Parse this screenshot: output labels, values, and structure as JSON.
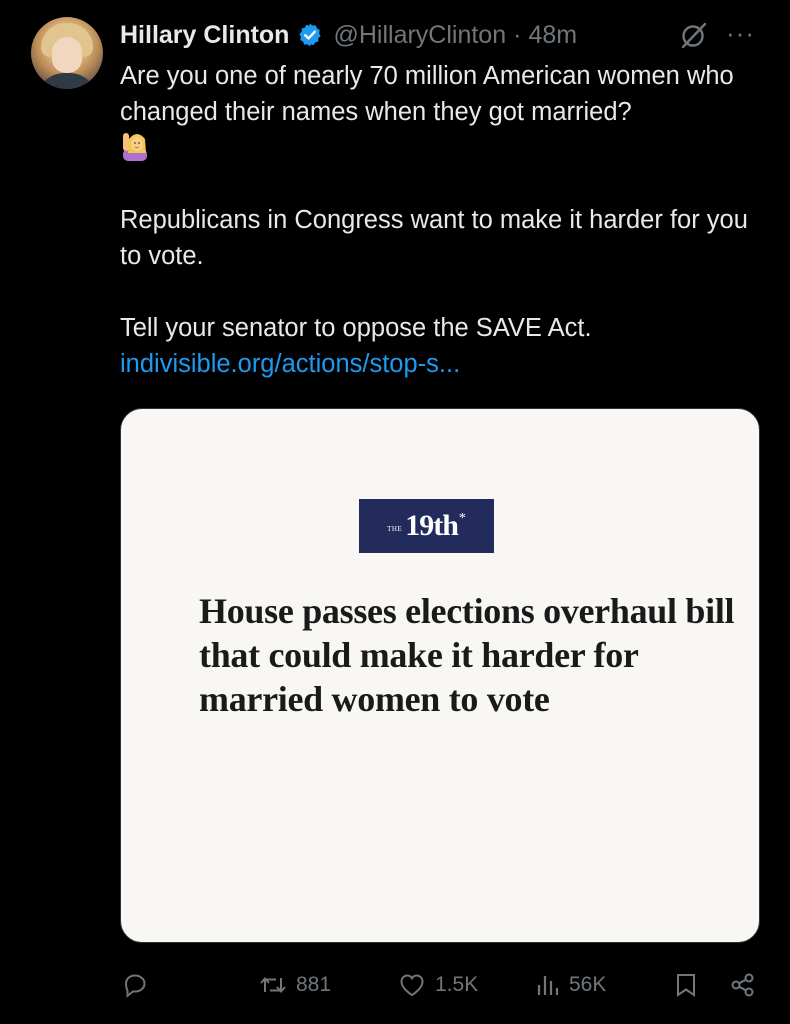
{
  "tweet": {
    "author_name": "Hillary Clinton",
    "handle": "@HillaryClinton",
    "separator": "·",
    "time": "48m",
    "more_label": "···",
    "lines": {
      "p1": "Are you one of nearly 70 million American women who changed their names when they got married?",
      "p2": "Republicans in Congress want to make it harder for you to vote.",
      "p3": "Tell your senator to oppose the SAVE Act.",
      "link": "indivisible.org/actions/stop-s..."
    },
    "emoji": "woman-raising-hand-emoji"
  },
  "card": {
    "logo_small": "THE",
    "logo_main": "19th",
    "logo_star": "*",
    "headline": "House passes elections overhaul bill that could make it harder for married women to vote"
  },
  "actions": {
    "replies": "",
    "reposts": "881",
    "likes": "1.5K",
    "views": "56K"
  },
  "colors": {
    "background": "#000000",
    "text": "#e7e9ea",
    "muted": "#71767b",
    "link": "#1d9bf0",
    "verified": "#1d9bf0",
    "card_bg": "#f9f7f4",
    "logo_bg": "#232a5c"
  }
}
